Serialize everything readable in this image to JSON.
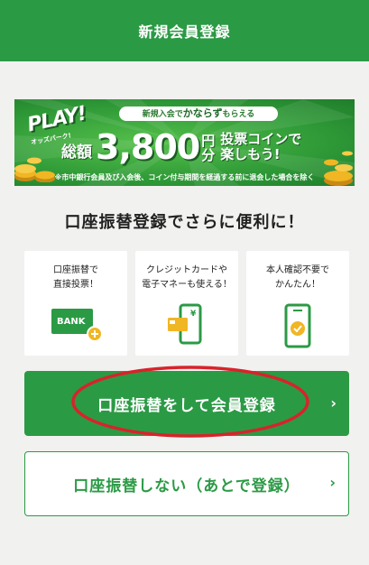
{
  "header": {
    "title": "新規会員登録"
  },
  "banner": {
    "logo_main": "PLAY!",
    "logo_sub": "オッズパーク!",
    "pill_prefix": "新規入会で",
    "pill_emphasis": "かならず",
    "pill_suffix": "もらえる",
    "amount_label": "総額",
    "amount": "3,800",
    "amount_unit_1": "円",
    "amount_unit_2": "分",
    "tag_line_1": "投票コインで",
    "tag_line_2": "楽しもう!",
    "note": "※市中銀行会員及び入会後、コイン付与期間を経過する前に退会した場合を除く"
  },
  "section_title": "口座振替登録でさらに便利に！",
  "features": [
    {
      "text": "口座振替で\n直接投票！",
      "icon": "bank-card-icon",
      "icon_label": "BANK"
    },
    {
      "text": "クレジットカードや\n電子マネーも使える！",
      "icon": "phone-card-yen-icon",
      "icon_label": "¥"
    },
    {
      "text": "本人確認不要で\nかんたん！",
      "icon": "phone-check-icon"
    }
  ],
  "buttons": {
    "primary_label": "口座振替をして会員登録",
    "secondary_label": "口座振替しない（あとで登録）",
    "chevron": "›"
  },
  "colors": {
    "brand_green": "#2b9a45",
    "annotation_red": "#d8232a",
    "coin_gold": "#f0b623"
  }
}
